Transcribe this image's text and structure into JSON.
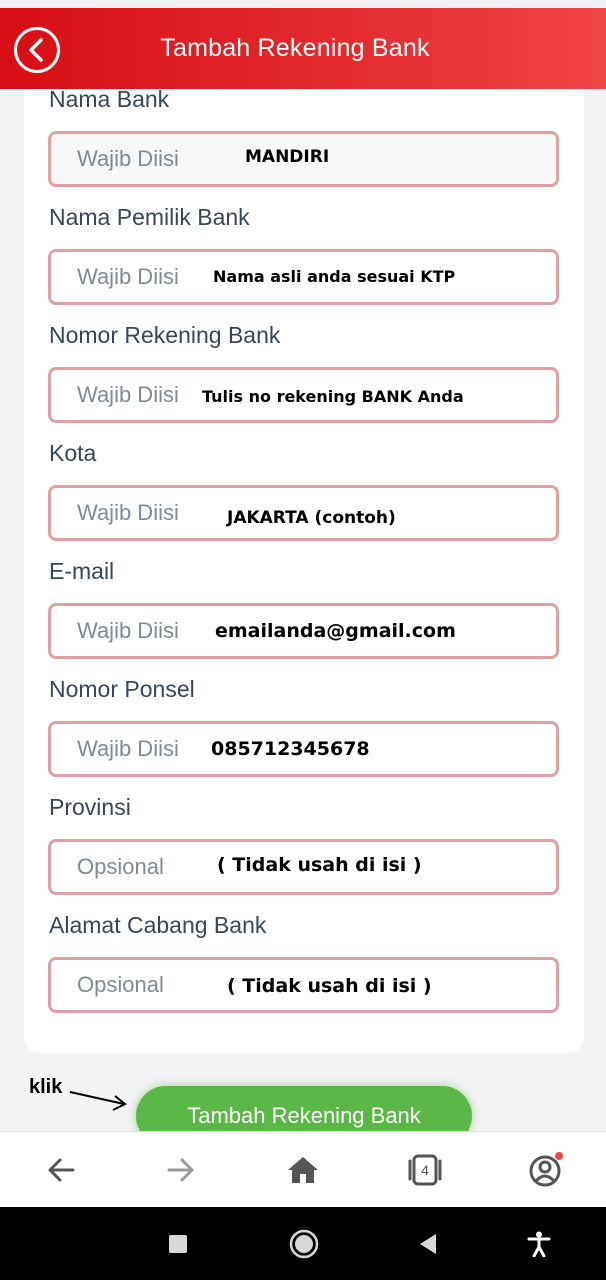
{
  "header": {
    "title": "Tambah Rekening Bank"
  },
  "form": {
    "fields": [
      {
        "label": "Nama Bank",
        "placeholder": "Wajib Diisi",
        "annotation": "MANDIRI"
      },
      {
        "label": "Nama Pemilik Bank",
        "placeholder": "Wajib Diisi",
        "annotation": "Nama asli anda sesuai KTP"
      },
      {
        "label": "Nomor Rekening Bank",
        "placeholder": "Wajib Diisi",
        "annotation": "Tulis no rekening BANK Anda"
      },
      {
        "label": "Kota",
        "placeholder": "Wajib Diisi",
        "annotation": "JAKARTA (contoh)"
      },
      {
        "label": "E-mail",
        "placeholder": "Wajib Diisi",
        "annotation": "emailanda@gmail.com"
      },
      {
        "label": "Nomor Ponsel",
        "placeholder": "Wajib Diisi",
        "annotation": "085712345678"
      },
      {
        "label": "Provinsi",
        "placeholder": "Opsional",
        "annotation": "( Tidak usah di isi )"
      },
      {
        "label": "Alamat Cabang Bank",
        "placeholder": "Opsional",
        "annotation": "( Tidak usah di isi )"
      }
    ]
  },
  "callout": {
    "text": "klik"
  },
  "submit": {
    "label": "Tambah Rekening Bank"
  },
  "browser_nav": {
    "tabs_count": "4",
    "icons": [
      "back-arrow-icon",
      "forward-arrow-icon",
      "home-icon",
      "tabs-icon",
      "profile-icon"
    ]
  },
  "system_nav": {
    "icons": [
      "recents-square-icon",
      "home-circle-icon",
      "back-triangle-icon",
      "accessibility-icon"
    ]
  },
  "colors": {
    "header": "#d70e14",
    "field_border": "#e0a0a3",
    "submit": "#5cb846",
    "notification_dot": "#f04545"
  }
}
